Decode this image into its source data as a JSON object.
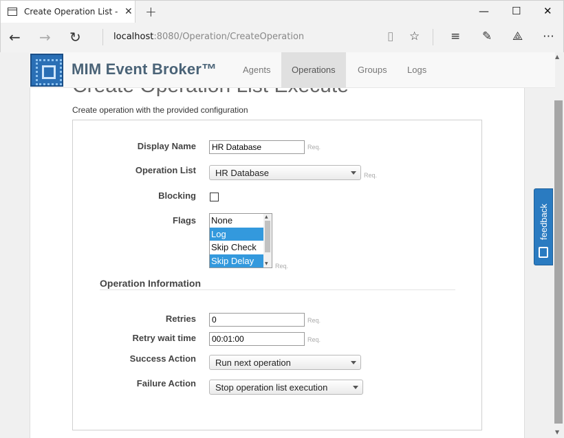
{
  "browser": {
    "tab_title": "Create Operation List - ",
    "url_host": "localhost",
    "url_rest": ":8080/Operation/CreateOperation"
  },
  "navbar": {
    "brand": "MIM Event Broker™",
    "links": [
      "Agents",
      "Operations",
      "Groups",
      "Logs"
    ],
    "active": "Operations"
  },
  "page": {
    "title": "Create Operation List Execute",
    "subtitle": "Create operation with the provided configuration"
  },
  "form": {
    "display_name_label": "Display Name",
    "display_name_value": "HR Database",
    "operation_list_label": "Operation List",
    "operation_list_value": "HR Database",
    "blocking_label": "Blocking",
    "blocking_checked": false,
    "flags_label": "Flags",
    "flags_options": [
      {
        "label": "None",
        "selected": false
      },
      {
        "label": "Log",
        "selected": true
      },
      {
        "label": "Skip Check",
        "selected": false
      },
      {
        "label": "Skip Delay",
        "selected": true
      }
    ],
    "req": "Req.",
    "section_title": "Operation Information",
    "retries_label": "Retries",
    "retries_value": "0",
    "retry_wait_label": "Retry wait time",
    "retry_wait_value": "00:01:00",
    "success_action_label": "Success Action",
    "success_action_value": "Run next operation",
    "failure_action_label": "Failure Action",
    "failure_action_value": "Stop operation list execution"
  },
  "feedback": {
    "label": "feedback"
  },
  "colors": {
    "accent": "#2a7bc1",
    "selected": "#3399dd"
  }
}
